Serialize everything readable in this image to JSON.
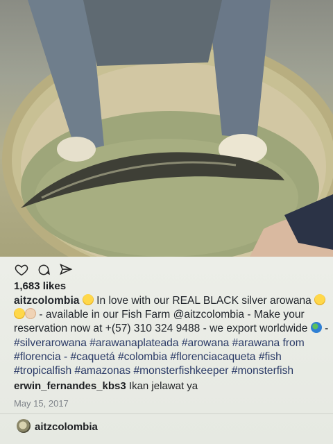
{
  "post": {
    "likes": "1,683 likes",
    "username": "aitzcolombia",
    "caption_text_1": " In love with our REAL BLACK silver arowana ",
    "caption_text_2": " - available in our Fish Farm @aitzcolombia - Make your reservation now at +(57) 310 324 9488 - we export worldwide ",
    "caption_text_3": " - ",
    "hashtags": "#silverarowana #arawanaplateada #arowana #arawana from #florencia - #caquetá #colombia #florenciacaqueta #fish #tropicalfish #amazonas #monsterfishkeeper #monsterfish",
    "date": "May 15, 2017"
  },
  "comment": {
    "username": "erwin_fernandes_kbs3",
    "text": " Ikan jelawat ya"
  },
  "footer": {
    "username": "aitzcolombia"
  },
  "icons": {
    "like": "heart-icon",
    "comment": "comment-icon",
    "share": "paper-plane-icon"
  },
  "colors": {
    "hashtag": "#2a3a66",
    "text": "#1d1f22",
    "date": "#7d8288"
  }
}
